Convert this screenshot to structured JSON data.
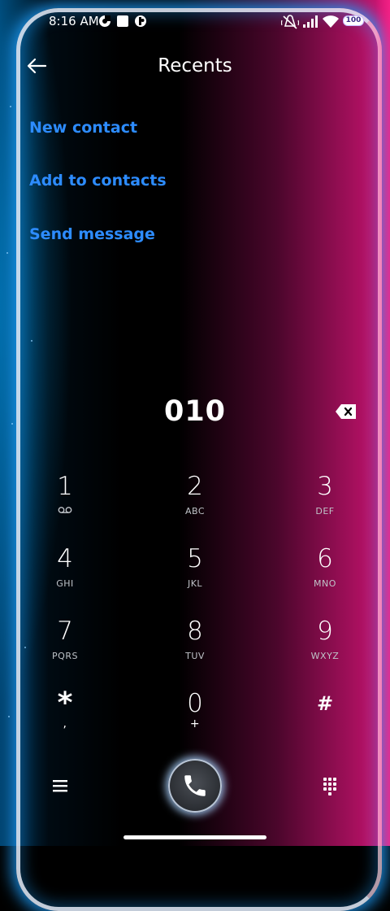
{
  "status_bar": {
    "time": "8:16 AM",
    "battery": "100"
  },
  "header": {
    "title": "Recents"
  },
  "options": [
    {
      "label": "New contact"
    },
    {
      "label": "Add to contacts"
    },
    {
      "label": "Send message"
    }
  ],
  "dialer": {
    "number": "010",
    "keys": [
      {
        "digit": "1",
        "letters": ""
      },
      {
        "digit": "2",
        "letters": "ABC"
      },
      {
        "digit": "3",
        "letters": "DEF"
      },
      {
        "digit": "4",
        "letters": "GHI"
      },
      {
        "digit": "5",
        "letters": "JKL"
      },
      {
        "digit": "6",
        "letters": "MNO"
      },
      {
        "digit": "7",
        "letters": "PQRS"
      },
      {
        "digit": "8",
        "letters": "TUV"
      },
      {
        "digit": "9",
        "letters": "WXYZ"
      },
      {
        "digit": "*",
        "letters": ","
      },
      {
        "digit": "0",
        "letters": "+"
      },
      {
        "digit": "#",
        "letters": ""
      }
    ]
  },
  "colors": {
    "accent": "#2d8cff",
    "glow_blue": "#1ea0ff",
    "glow_pink": "#e0157a"
  }
}
